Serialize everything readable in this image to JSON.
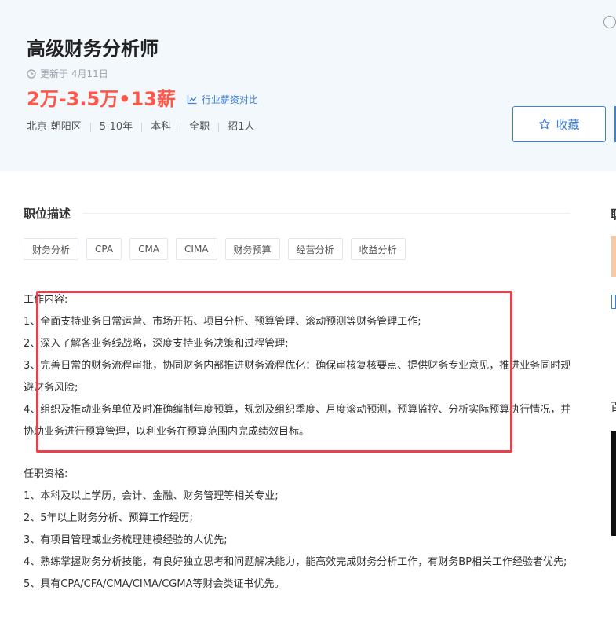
{
  "job": {
    "title": "高级财务分析师",
    "updated": "更新于 4月11日",
    "salary": "2万-3.5万•13薪",
    "compare_label": "行业薪资对比",
    "meta": [
      "北京-朝阳区",
      "5-10年",
      "本科",
      "全职",
      "招1人"
    ],
    "favorite_label": "收藏"
  },
  "description": {
    "heading": "职位描述",
    "tags": [
      "财务分析",
      "CPA",
      "CMA",
      "CIMA",
      "财务预算",
      "经营分析",
      "收益分析"
    ],
    "duties_title": "工作内容:",
    "duties": [
      "1、全面支持业务日常运营、市场开拓、项目分析、预算管理、滚动预测等财务管理工作;",
      "2、深入了解各业务线战略，深度支持业务决策和过程管理;",
      "3、完善日常的财务流程审批，协同财务内部推进财务流程优化：确保审核复核要点、提供财务专业意见，推进业务同时规避财务风险;",
      "4、组织及推动业务单位及时准确编制年度预算，规划及组织季度、月度滚动预测，预算监控、分析实际预算执行情况，并协助业务进行预算管理，以利业务在预算范围内完成绩效目标。"
    ],
    "requirements_title": "任职资格:",
    "requirements": [
      "1、本科及以上学历，会计、金融、财务管理等相关专业;",
      "2、5年以上财务分析、预算工作经历;",
      "3、有项目管理或业务梳理建模经验的人优先;",
      "4、熟练掌握财务分析技能，有良好独立思考和问题解决能力，能高效完成财务分析工作，有财务BP相关工作经验者优先;",
      "5、具有CPA/CFA/CMA/CIMA/CGMA等财会类证书优先。"
    ]
  },
  "sidebar": {
    "heading_fragment": "职",
    "fragment_2": "百"
  },
  "colors": {
    "accent": "#3f80d7",
    "salary": "#fe574a",
    "highlight": "#e8404c",
    "header_bg": "#f3f8fc"
  },
  "icons": [
    "clock-icon",
    "chart-icon",
    "star-icon",
    "info-icon"
  ]
}
